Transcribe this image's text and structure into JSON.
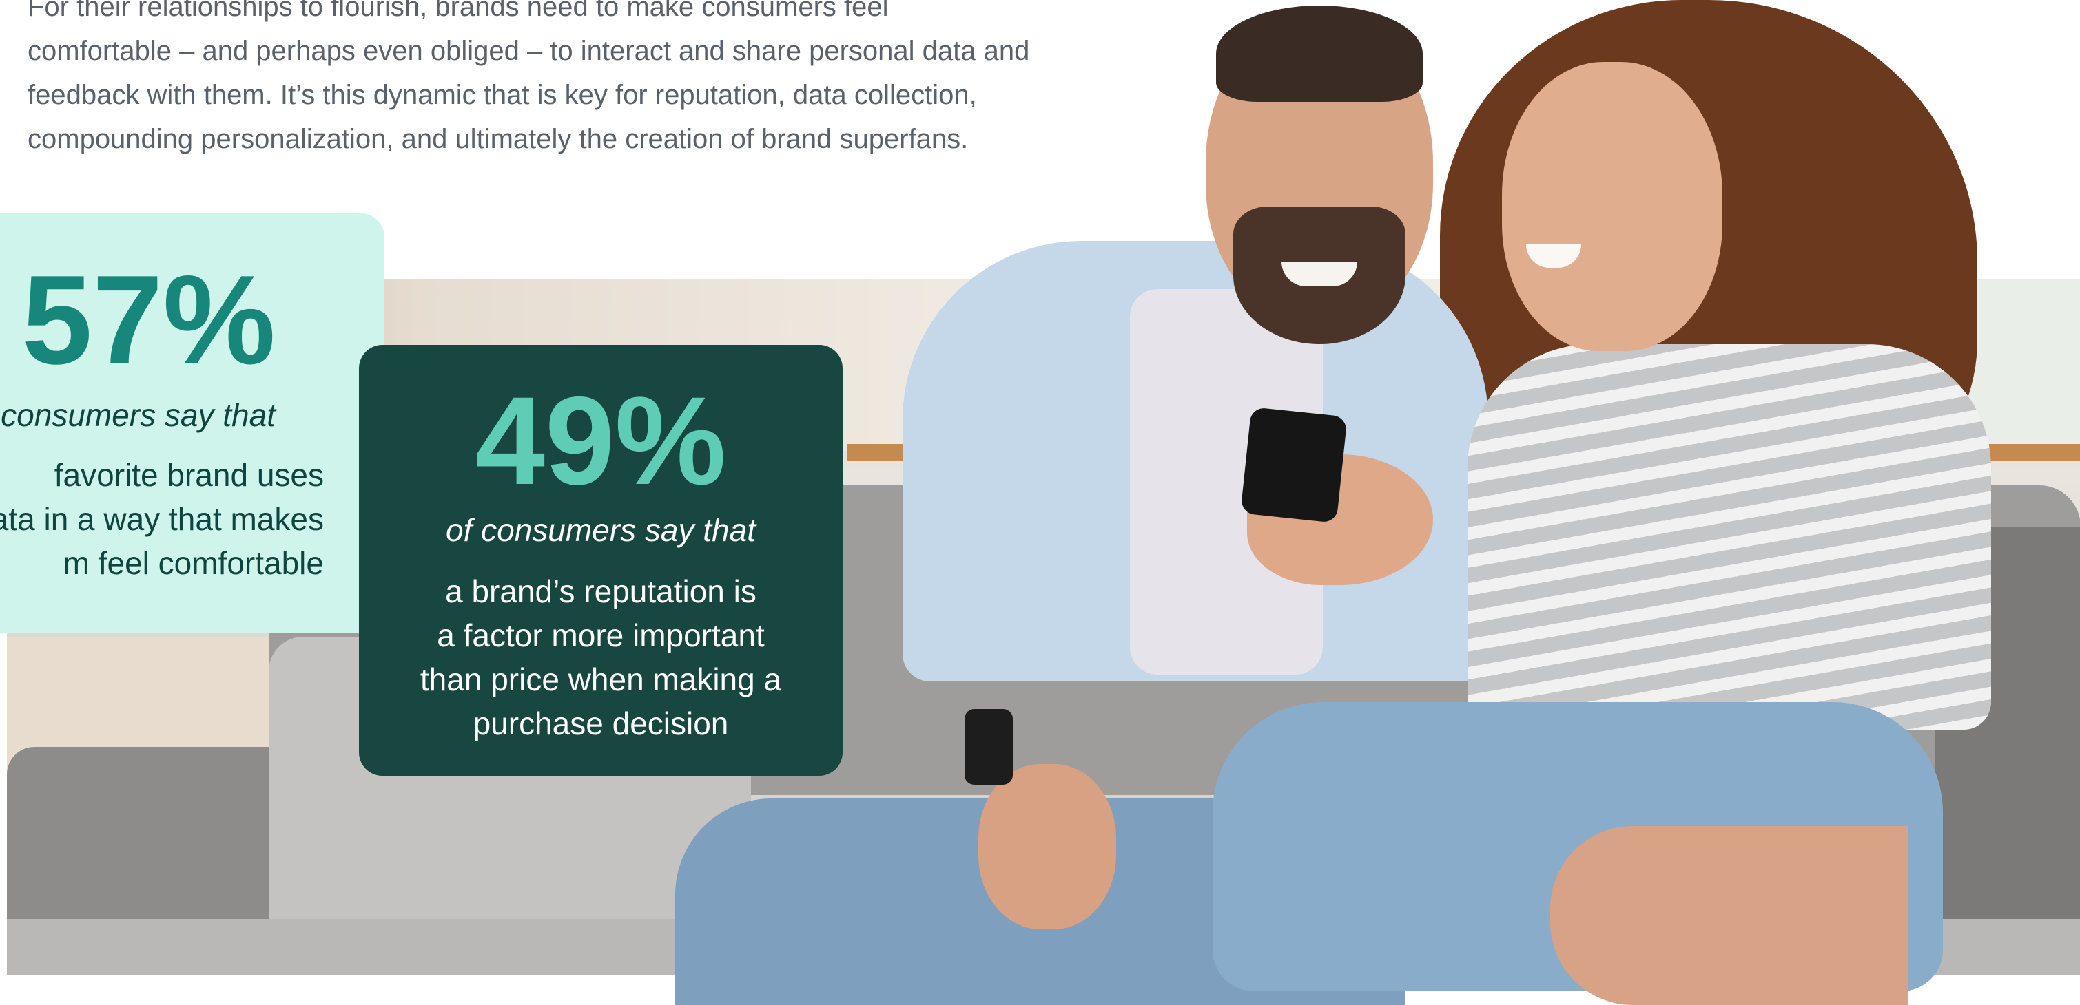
{
  "intro": {
    "lines": [
      "For their relationships to flourish, brands need to make consumers feel",
      "comfortable – and perhaps even obliged – to interact and share personal data and",
      "feedback with them. It’s this dynamic that is key for reputation, data collection,",
      "compounding personalization, and ultimately the creation of brand superfans."
    ]
  },
  "stats": [
    {
      "percent": "57%",
      "lead": "consumers say that",
      "body_lines": [
        "favorite brand uses",
        "ata in a way that makes",
        "m feel comfortable"
      ],
      "colors": {
        "background": "#cef4ec",
        "percent": "#17877b",
        "text": "#10453f"
      }
    },
    {
      "percent": "49%",
      "lead": "of consumers say that",
      "body_lines": [
        "a brand’s reputation is",
        "a factor more important",
        "than price when making a",
        "purchase decision"
      ],
      "colors": {
        "background": "#184641",
        "percent": "#5fcdb5",
        "text": "#ffffff"
      }
    }
  ],
  "photo": {
    "subject": "couple-laughing-at-phone-on-sofa"
  }
}
